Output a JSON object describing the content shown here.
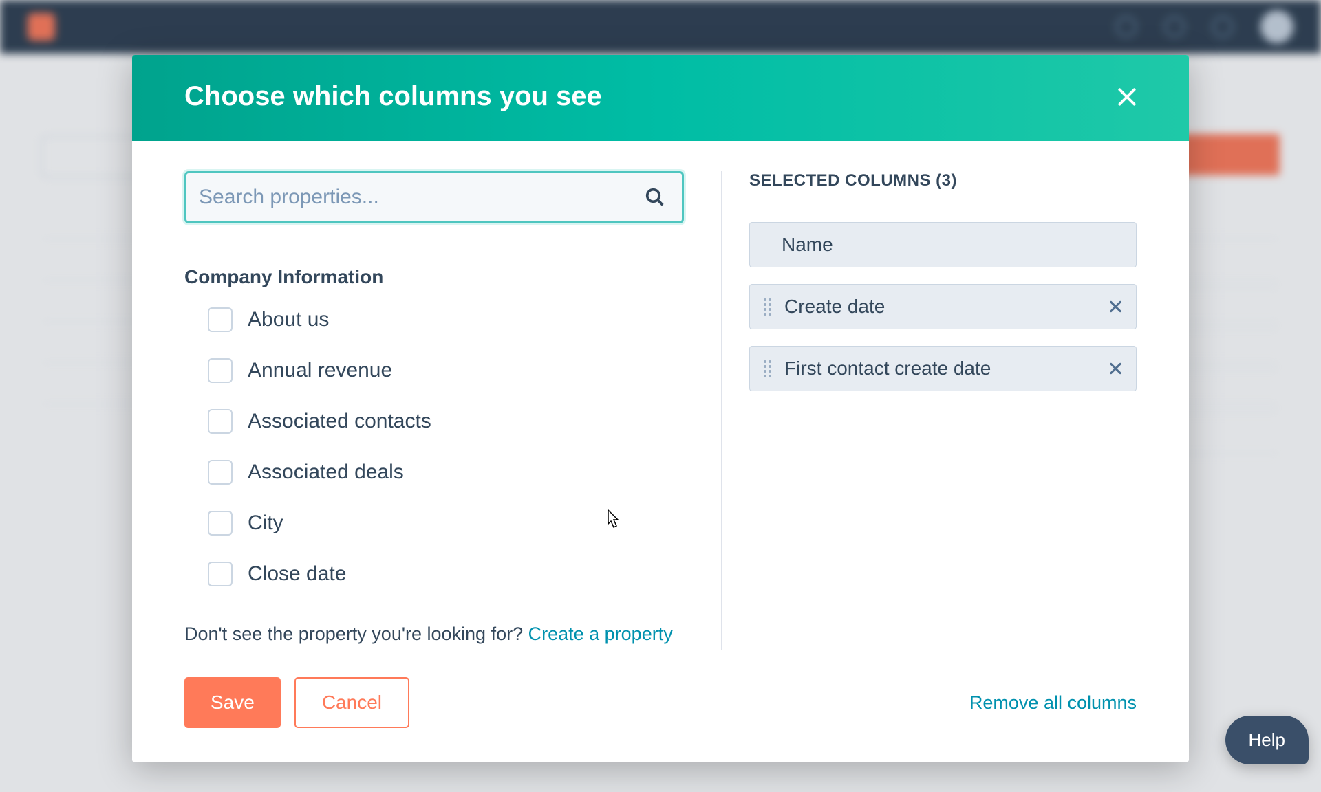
{
  "modal": {
    "title": "Choose which columns you see",
    "search": {
      "placeholder": "Search properties..."
    },
    "group_title": "Company Information",
    "properties": [
      {
        "label": "About us"
      },
      {
        "label": "Annual revenue"
      },
      {
        "label": "Associated contacts"
      },
      {
        "label": "Associated deals"
      },
      {
        "label": "City"
      },
      {
        "label": "Close date"
      }
    ],
    "hint_prefix": "Don't see the property you're looking for? ",
    "hint_link": "Create a property",
    "selected_header": "SELECTED COLUMNS (3)",
    "selected": [
      {
        "label": "Name",
        "draggable": false,
        "removable": false
      },
      {
        "label": "Create date",
        "draggable": true,
        "removable": true
      },
      {
        "label": "First contact create date",
        "draggable": true,
        "removable": true
      }
    ],
    "save": "Save",
    "cancel": "Cancel",
    "remove_all": "Remove all columns"
  },
  "help": {
    "label": "Help"
  }
}
